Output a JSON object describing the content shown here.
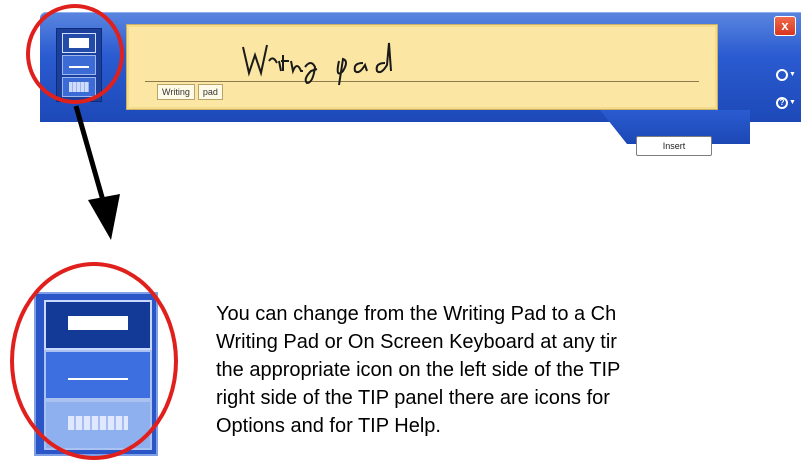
{
  "tip_panel": {
    "ink_text": "Writing pad",
    "suggestions": [
      "Writing",
      "pad"
    ],
    "insert_label": "Insert",
    "close_label": "x",
    "mode_buttons": [
      "writing-pad",
      "character-pad",
      "on-screen-keyboard"
    ]
  },
  "description": {
    "lines": [
      "You can change from the Writing Pad to a Ch",
      "Writing Pad or On Screen Keyboard at any tir",
      "the appropriate icon on the left side of the TIP",
      "right side of the TIP panel there are icons for",
      "Options and for TIP Help."
    ]
  },
  "colors": {
    "panel_blue": "#2a5bd0",
    "writing_area": "#fbe7a3",
    "annotation_red": "#e0201c"
  }
}
